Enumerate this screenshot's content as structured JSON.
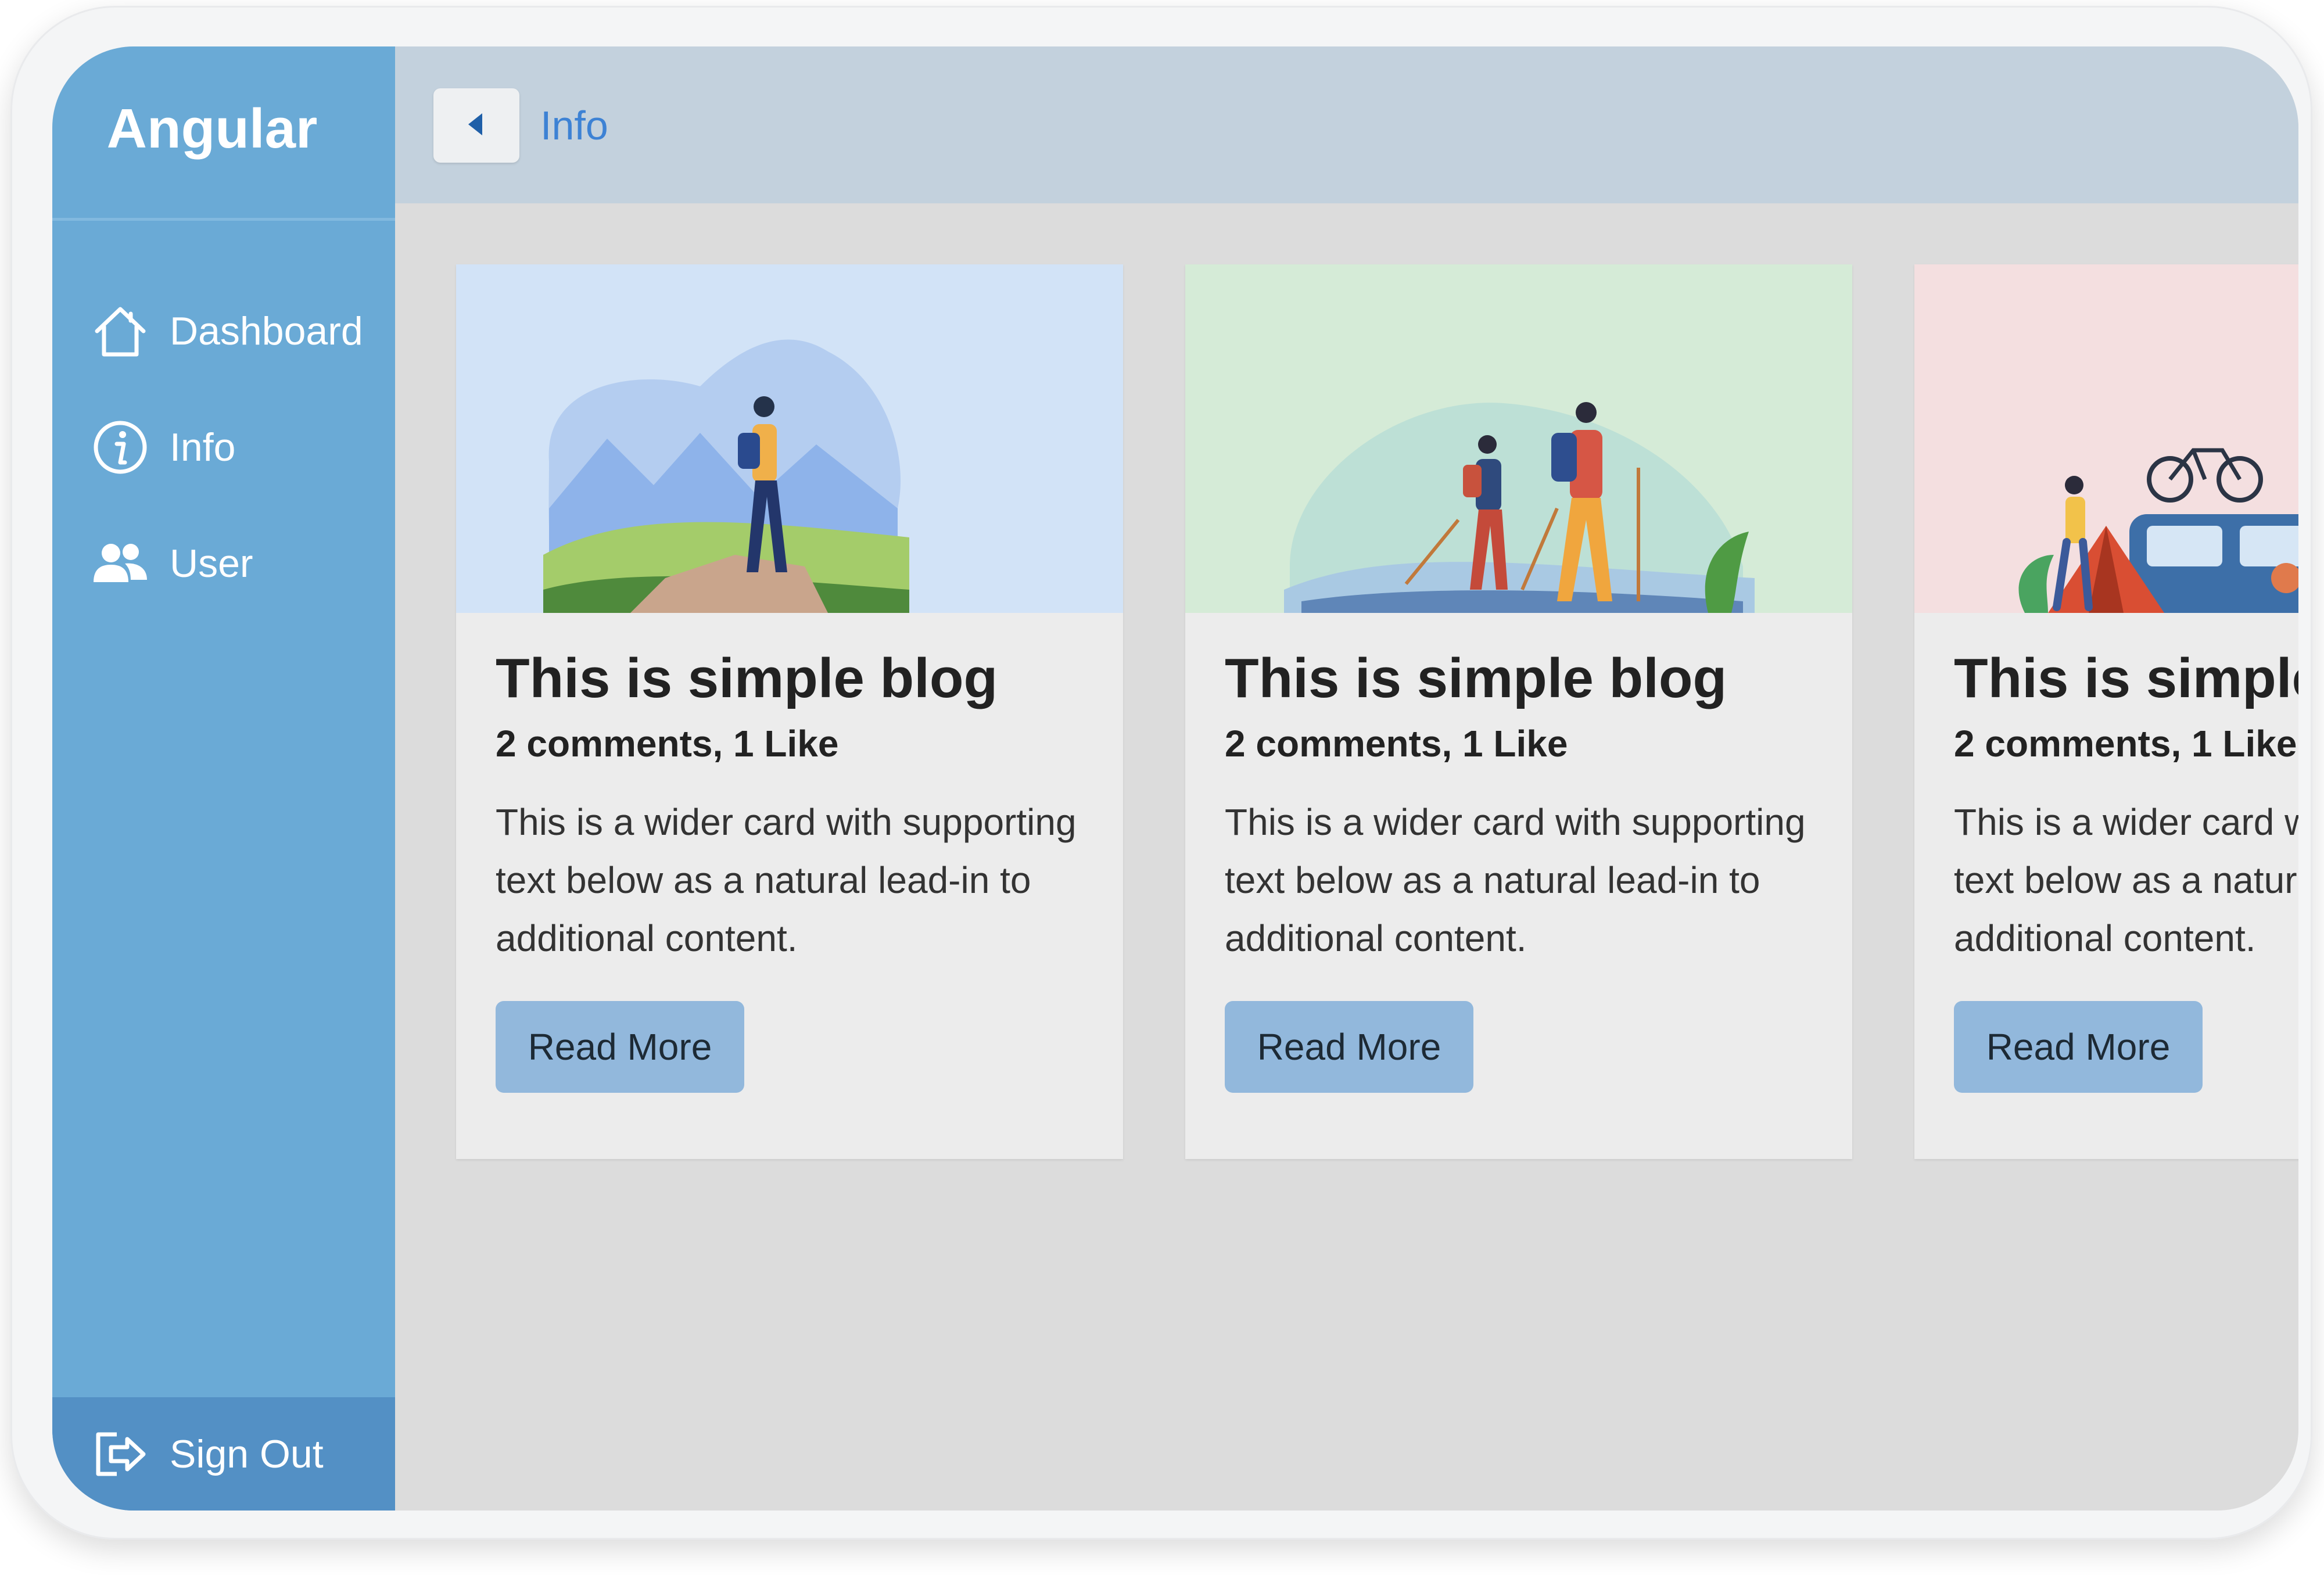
{
  "app": {
    "brand": "Angular"
  },
  "sidebar": {
    "items": [
      {
        "label": "Dashboard",
        "icon": "home-icon"
      },
      {
        "label": "Info",
        "icon": "info-icon"
      },
      {
        "label": "User",
        "icon": "users-icon"
      }
    ],
    "signout_label": "Sign Out",
    "signout_icon": "sign-out-icon"
  },
  "topbar": {
    "title": "Info",
    "back_icon": "caret-left-icon"
  },
  "cards": [
    {
      "title": "This is simple blog",
      "meta": "2 comments, 1 Like",
      "text": "This is a wider card with supporting text below as a natural lead-in to additional content.",
      "button": "Read More",
      "image_bg": "#d2e3f7"
    },
    {
      "title": "This is simple blog",
      "meta": "2 comments, 1 Like",
      "text": "This is a wider card with supporting text below as a natural lead-in to additional content.",
      "button": "Read More",
      "image_bg": "#d5ebd7"
    },
    {
      "title": "This is simple blog",
      "meta": "2 comments, 1 Like",
      "text": "This is a wider card with supporting text below as a natural lead-in to additional content.",
      "button": "Read More",
      "image_bg": "#f4dfe0"
    }
  ],
  "colors": {
    "sidebar": "#6aaad6",
    "signout": "#5390c5",
    "topbar": "#c3d1dd",
    "accent": "#3d82d4",
    "button": "#92b8dc",
    "content_bg": "#dcdcdc"
  }
}
